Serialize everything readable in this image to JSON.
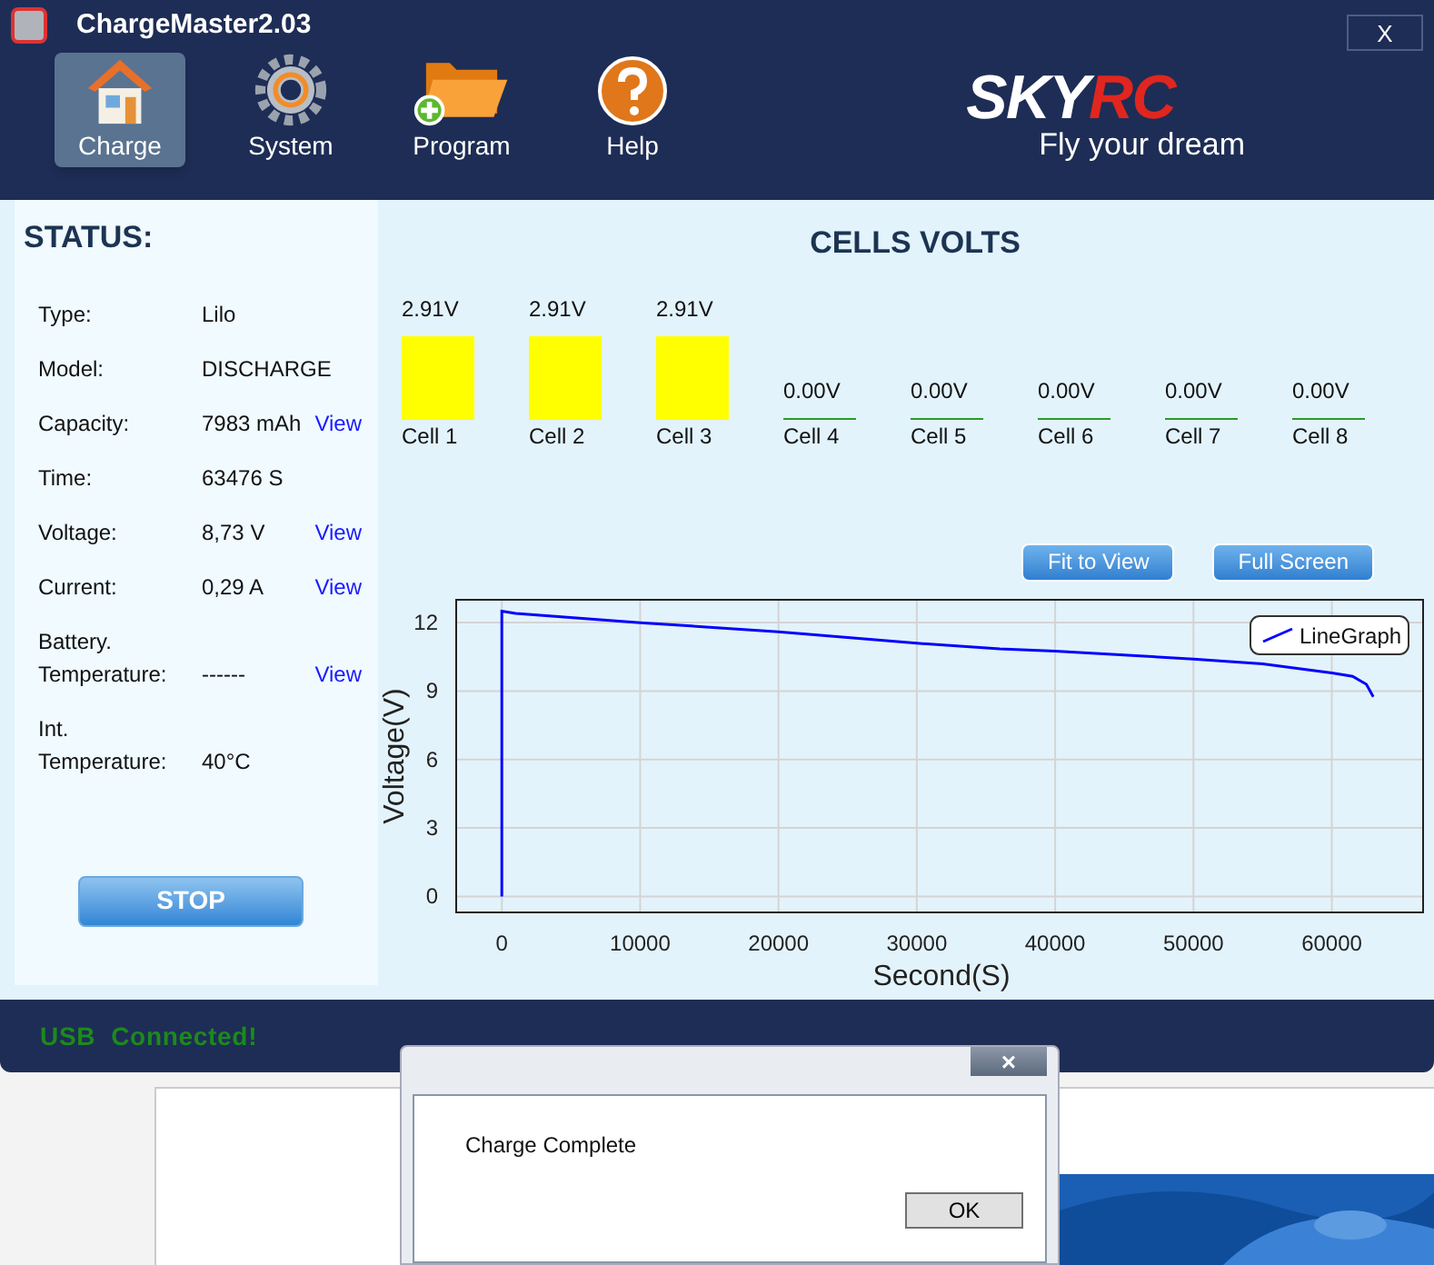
{
  "window": {
    "title": "ChargeMaster2.03",
    "close": "X"
  },
  "nav": [
    {
      "label": "Charge",
      "kind": "home",
      "selected": true
    },
    {
      "label": "System",
      "kind": "gear",
      "selected": false
    },
    {
      "label": "Program",
      "kind": "folder",
      "selected": false
    },
    {
      "label": "Help",
      "kind": "help",
      "selected": false
    }
  ],
  "brand": {
    "logo_a": "SKY",
    "logo_b": "RC",
    "slogan": "Fly your dream"
  },
  "status": {
    "title": "STATUS:",
    "rows": [
      {
        "label": "Type:",
        "value": "Lilo"
      },
      {
        "label": "Model:",
        "value": "DISCHARGE"
      },
      {
        "label": "Capacity:",
        "value": "7983 mAh",
        "link": "View"
      },
      {
        "label": "Time:",
        "value": "63476 S"
      },
      {
        "label": "Voltage:",
        "value": "8,73 V",
        "link": "View"
      },
      {
        "label": "Current:",
        "value": "0,29 A",
        "link": "View"
      },
      {
        "label": "Battery.\nTemperature:",
        "value": "------",
        "link": "View"
      },
      {
        "label": "Int.\nTemperature:",
        "value": "40°C"
      }
    ],
    "stop_button": "STOP"
  },
  "cells": {
    "title": "CELLS VOLTS",
    "items": [
      {
        "name": "Cell 1",
        "reading": "2.91V",
        "kind": "bar"
      },
      {
        "name": "Cell 2",
        "reading": "2.91V",
        "kind": "bar"
      },
      {
        "name": "Cell 3",
        "reading": "2.91V",
        "kind": "bar"
      },
      {
        "name": "Cell 4",
        "reading": "0.00V",
        "kind": "empty"
      },
      {
        "name": "Cell 5",
        "reading": "0.00V",
        "kind": "empty"
      },
      {
        "name": "Cell 6",
        "reading": "0.00V",
        "kind": "empty"
      },
      {
        "name": "Cell 7",
        "reading": "0.00V",
        "kind": "empty"
      },
      {
        "name": "Cell 8",
        "reading": "0.00V",
        "kind": "empty"
      }
    ]
  },
  "graph_buttons": [
    "Fit to View",
    "Full Screen"
  ],
  "chart_data": {
    "type": "line",
    "xlabel": "Second(S)",
    "ylabel": "Voltage(V)",
    "x": [
      0,
      0,
      1000,
      10000,
      20000,
      30000,
      36000,
      40000,
      50000,
      55000,
      60000,
      61500,
      62500,
      63000
    ],
    "series": [
      {
        "name": "LineGraph",
        "color": "#0000ff",
        "values": [
          0,
          12.5,
          12.4,
          12.0,
          11.6,
          11.1,
          10.85,
          10.75,
          10.4,
          10.2,
          9.8,
          9.65,
          9.3,
          8.75
        ]
      }
    ],
    "xticks": [
      0,
      10000,
      20000,
      30000,
      40000,
      50000,
      60000
    ],
    "yticks": [
      0,
      3,
      6,
      9,
      12
    ],
    "xlim": [
      -3300,
      66600
    ],
    "ylim": [
      -0.7,
      13
    ],
    "grid": true
  },
  "status_bar": "USB  Connected!",
  "dialog": {
    "message": "Charge Complete",
    "ok": "OK",
    "close": "×"
  }
}
